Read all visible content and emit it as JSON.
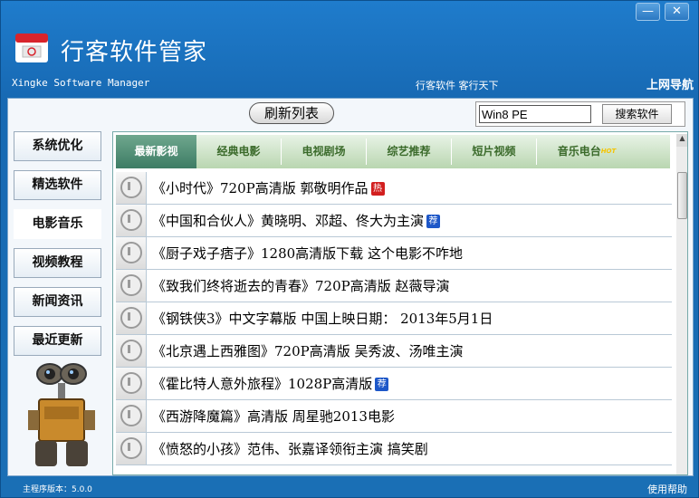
{
  "window": {
    "minimize_label": "—",
    "close_label": "✕"
  },
  "header": {
    "title": "行客软件管家",
    "subtitle": "Xingke Software Manager",
    "slogan": "行客软件  客行天下",
    "nav_link": "上网导航"
  },
  "toolbar": {
    "refresh_label": "刷新列表",
    "search_value": "Win8 PE",
    "search_button": "搜索软件"
  },
  "sidebar": {
    "items": [
      {
        "label": "系统优化"
      },
      {
        "label": "精选软件"
      },
      {
        "label": "电影音乐"
      },
      {
        "label": "视频教程"
      },
      {
        "label": "新闻资讯"
      },
      {
        "label": "最近更新"
      }
    ],
    "active_index": 2
  },
  "tabs": [
    {
      "label": "最新影视"
    },
    {
      "label": "经典电影"
    },
    {
      "label": "电视剧场"
    },
    {
      "label": "综艺推荐"
    },
    {
      "label": "短片视频"
    },
    {
      "label": "音乐电台",
      "badge": "HOT"
    }
  ],
  "list": [
    {
      "text": "《小时代》720P高清版  郭敬明作品",
      "badge": "热",
      "badge_type": "hot"
    },
    {
      "text": "《中国和合伙人》黄晓明、邓超、佟大为主演",
      "badge": "荐",
      "badge_type": "rec"
    },
    {
      "text": "《厨子戏子痞子》1280高清版下载  这个电影不咋地"
    },
    {
      "text": "《致我们终将逝去的青春》720P高清版  赵薇导演"
    },
    {
      "text": "《钢铁侠3》中文字幕版    中国上映日期：  2013年5月1日"
    },
    {
      "text": "《北京遇上西雅图》720P高清版  吴秀波、汤唯主演"
    },
    {
      "text": "《霍比特人意外旅程》1028P高清版",
      "badge": "荐",
      "badge_type": "rec"
    },
    {
      "text": "《西游降魔篇》高清版  周星驰2013电影"
    },
    {
      "text": "《愤怒的小孩》范伟、张嘉译领衔主演  搞笑剧"
    }
  ],
  "status": {
    "version": "主程序版本：5.0.0",
    "help": "使用帮助"
  },
  "colors": {
    "accent": "#1a6fb5",
    "tab_active": "#3d7c64",
    "hot_badge": "#d21f1f",
    "rec_badge": "#1d57c8"
  }
}
